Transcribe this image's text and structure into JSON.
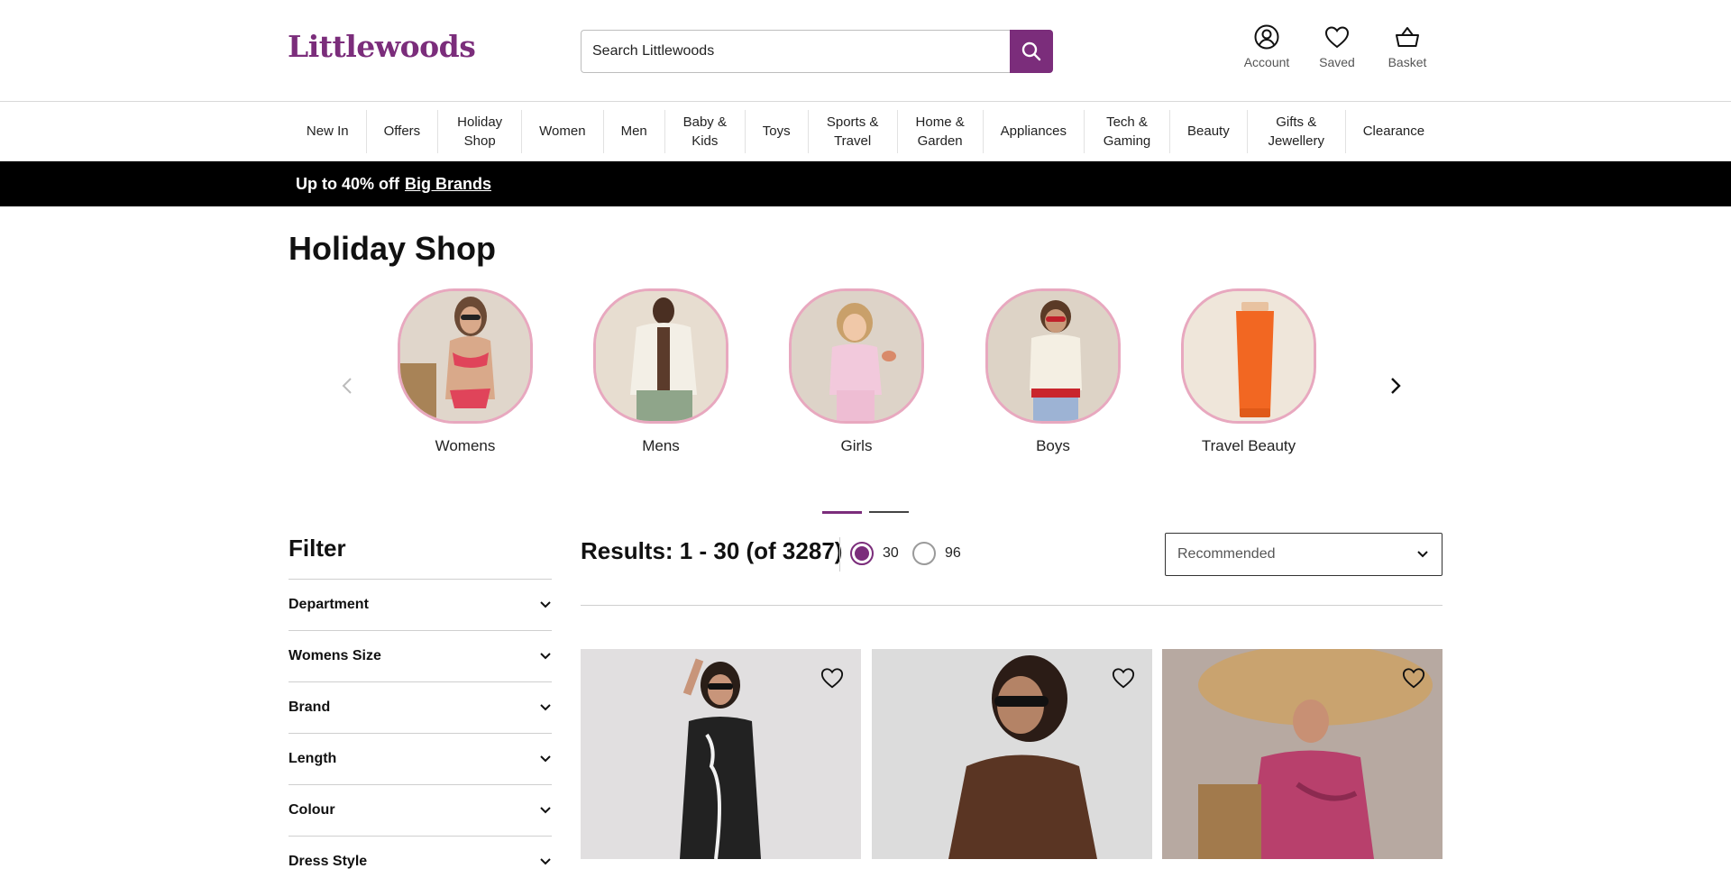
{
  "header": {
    "logo": "Littlewoods",
    "search_placeholder": "Search Littlewoods",
    "account": "Account",
    "saved": "Saved",
    "basket": "Basket"
  },
  "nav": [
    "New In",
    "Offers",
    "Holiday Shop",
    "Women",
    "Men",
    "Baby & Kids",
    "Toys",
    "Sports & Travel",
    "Home & Garden",
    "Appliances",
    "Tech & Gaming",
    "Beauty",
    "Gifts & Jewellery",
    "Clearance"
  ],
  "promo": {
    "text": "Up to 40% off",
    "link": "Big Brands"
  },
  "page_title": "Holiday Shop",
  "categories": [
    "Womens",
    "Mens",
    "Girls",
    "Boys",
    "Travel Beauty"
  ],
  "carousel": {
    "pages": 2,
    "active_page": 1
  },
  "filter": {
    "title": "Filter",
    "groups": [
      "Department",
      "Womens Size",
      "Brand",
      "Length",
      "Colour",
      "Dress Style"
    ]
  },
  "results": {
    "text": "Results: 1 - 30 (of 3287)",
    "per_page_options": [
      "30",
      "96"
    ],
    "per_page_selected": "30",
    "sort_selected": "Recommended"
  },
  "colors": {
    "brand": "#7b2d7b",
    "promo_bg": "#000000",
    "category_border": "#e8a8bf"
  }
}
